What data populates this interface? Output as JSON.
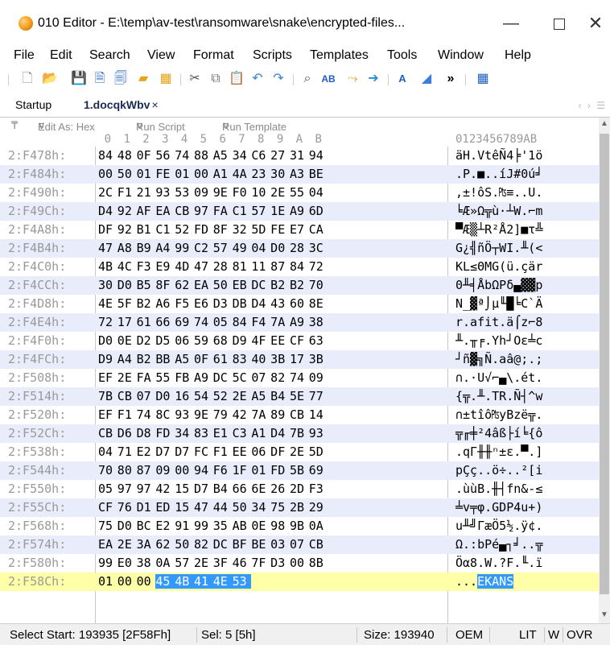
{
  "window": {
    "title": "010 Editor - E:\\temp\\av-test\\ransomware\\snake\\encrypted-files...",
    "min_glyph": "—",
    "close_glyph": "✕"
  },
  "menu": [
    "File",
    "Edit",
    "Search",
    "View",
    "Format",
    "Scripts",
    "Templates",
    "Tools",
    "Window",
    "Help"
  ],
  "toolbar": {
    "icons": [
      "new-file-icon",
      "open-icon",
      "save-icon",
      "save-as-icon",
      "save-all-icon",
      "open-folder-icon",
      "workspace-icon",
      "cut-icon",
      "copy-icon",
      "paste-icon",
      "undo-icon",
      "redo-icon",
      "find-icon",
      "replace-icon",
      "find-in-files-icon",
      "goto-icon",
      "font-icon",
      "highlight-icon",
      "calculator-icon"
    ],
    "more_glyph": "»"
  },
  "tabs": {
    "startup": "Startup",
    "active": "1.docqkWbv",
    "close_glyph": "×"
  },
  "subbar": {
    "edit_as": "Edit As: Hex",
    "run_script": "Run Script",
    "run_template": "Run Template"
  },
  "colors": {
    "row_alt": "#e9ecfb",
    "last_row": "#ffffa8",
    "selection": "#3399ff"
  },
  "hex_columns": [
    "0",
    "1",
    "2",
    "3",
    "4",
    "5",
    "6",
    "7",
    "8",
    "9",
    "A",
    "B"
  ],
  "ascii_header": "0123456789AB",
  "rows": [
    {
      "addr": "2:F478h:",
      "hex": [
        "84",
        "48",
        "0F",
        "56",
        "74",
        "88",
        "A5",
        "34",
        "C6",
        "27",
        "31",
        "94"
      ],
      "ascii": "äH.VtêÑ4╞'1ö"
    },
    {
      "addr": "2:F484h:",
      "hex": [
        "00",
        "50",
        "01",
        "FE",
        "01",
        "00",
        "A1",
        "4A",
        "23",
        "30",
        "A3",
        "BE"
      ],
      "ascii": ".P.■..íJ#0ú╛"
    },
    {
      "addr": "2:F490h:",
      "hex": [
        "2C",
        "F1",
        "21",
        "93",
        "53",
        "09",
        "9E",
        "F0",
        "10",
        "2E",
        "55",
        "04"
      ],
      "ascii": ",±!ôS.₧≡..U."
    },
    {
      "addr": "2:F49Ch:",
      "hex": [
        "D4",
        "92",
        "AF",
        "EA",
        "CB",
        "97",
        "FA",
        "C1",
        "57",
        "1E",
        "A9",
        "6D"
      ],
      "ascii": "╘Æ»Ω╦ù·┴W.⌐m"
    },
    {
      "addr": "2:F4A8h:",
      "hex": [
        "DF",
        "92",
        "B1",
        "C1",
        "52",
        "FD",
        "8F",
        "32",
        "5D",
        "FE",
        "E7",
        "CA"
      ],
      "ascii": "▀Æ▒┴R²Å2]■τ╩"
    },
    {
      "addr": "2:F4B4h:",
      "hex": [
        "47",
        "A8",
        "B9",
        "A4",
        "99",
        "C2",
        "57",
        "49",
        "04",
        "D0",
        "28",
        "3C"
      ],
      "ascii": "G¿╣ñÖ┬WI.╨(<"
    },
    {
      "addr": "2:F4C0h:",
      "hex": [
        "4B",
        "4C",
        "F3",
        "E9",
        "4D",
        "47",
        "28",
        "81",
        "11",
        "87",
        "84",
        "72"
      ],
      "ascii": "KL≤ΘMG(ü.çär"
    },
    {
      "addr": "2:F4CCh:",
      "hex": [
        "30",
        "D0",
        "B5",
        "8F",
        "62",
        "EA",
        "50",
        "EB",
        "DC",
        "B2",
        "B2",
        "70"
      ],
      "ascii": "0╨╡ÅbΩPδ▄▓▓p"
    },
    {
      "addr": "2:F4D8h:",
      "hex": [
        "4E",
        "5F",
        "B2",
        "A6",
        "F5",
        "E6",
        "D3",
        "DB",
        "D4",
        "43",
        "60",
        "8E"
      ],
      "ascii": "N_▓ª⌡µ╙█╘C`Ä"
    },
    {
      "addr": "2:F4E4h:",
      "hex": [
        "72",
        "17",
        "61",
        "66",
        "69",
        "74",
        "05",
        "84",
        "F4",
        "7A",
        "A9",
        "38"
      ],
      "ascii": "r.afit.ä⌠z⌐8"
    },
    {
      "addr": "2:F4F0h:",
      "hex": [
        "D0",
        "0E",
        "D2",
        "D5",
        "06",
        "59",
        "68",
        "D9",
        "4F",
        "EE",
        "CF",
        "63"
      ],
      "ascii": "╨.╥╒.Yh┘Oε╧c"
    },
    {
      "addr": "2:F4FCh:",
      "hex": [
        "D9",
        "A4",
        "B2",
        "BB",
        "A5",
        "0F",
        "61",
        "83",
        "40",
        "3B",
        "17",
        "3B"
      ],
      "ascii": "┘ñ▓╗Ñ.aâ@;.;"
    },
    {
      "addr": "2:F508h:",
      "hex": [
        "EF",
        "2E",
        "FA",
        "55",
        "FB",
        "A9",
        "DC",
        "5C",
        "07",
        "82",
        "74",
        "09"
      ],
      "ascii": "∩.·U√⌐▄\\.ét."
    },
    {
      "addr": "2:F514h:",
      "hex": [
        "7B",
        "CB",
        "07",
        "D0",
        "16",
        "54",
        "52",
        "2E",
        "A5",
        "B4",
        "5E",
        "77"
      ],
      "ascii": "{╦.╨.TR.Ñ┤^w"
    },
    {
      "addr": "2:F520h:",
      "hex": [
        "EF",
        "F1",
        "74",
        "8C",
        "93",
        "9E",
        "79",
        "42",
        "7A",
        "89",
        "CB",
        "14"
      ],
      "ascii": "∩±tîô₧yBzë╦."
    },
    {
      "addr": "2:F52Ch:",
      "hex": [
        "CB",
        "D6",
        "D8",
        "FD",
        "34",
        "83",
        "E1",
        "C3",
        "A1",
        "D4",
        "7B",
        "93"
      ],
      "ascii": "╦╓╪²4âß├í╘{ô"
    },
    {
      "addr": "2:F538h:",
      "hex": [
        "04",
        "71",
        "E2",
        "D7",
        "D7",
        "FC",
        "F1",
        "EE",
        "06",
        "DF",
        "2E",
        "5D"
      ],
      "ascii": ".qΓ╫╫ⁿ±ε.▀.]"
    },
    {
      "addr": "2:F544h:",
      "hex": [
        "70",
        "80",
        "87",
        "09",
        "00",
        "94",
        "F6",
        "1F",
        "01",
        "FD",
        "5B",
        "69"
      ],
      "ascii": "pÇç..ö÷..²[i"
    },
    {
      "addr": "2:F550h:",
      "hex": [
        "05",
        "97",
        "97",
        "42",
        "15",
        "D7",
        "B4",
        "66",
        "6E",
        "26",
        "2D",
        "F3"
      ],
      "ascii": ".ùùB.╫┤fn&-≤"
    },
    {
      "addr": "2:F55Ch:",
      "hex": [
        "CF",
        "76",
        "D1",
        "ED",
        "15",
        "47",
        "44",
        "50",
        "34",
        "75",
        "2B",
        "29"
      ],
      "ascii": "╧v╤φ.GDP4u+)"
    },
    {
      "addr": "2:F568h:",
      "hex": [
        "75",
        "D0",
        "BC",
        "E2",
        "91",
        "99",
        "35",
        "AB",
        "0E",
        "98",
        "9B",
        "0A"
      ],
      "ascii": "u╨╝ΓæÖ5½.ÿ¢."
    },
    {
      "addr": "2:F574h:",
      "hex": [
        "EA",
        "2E",
        "3A",
        "62",
        "50",
        "82",
        "DC",
        "BF",
        "BE",
        "03",
        "07",
        "CB"
      ],
      "ascii": "Ω.:bPé▄┐╛..╦"
    },
    {
      "addr": "2:F580h:",
      "hex": [
        "99",
        "E0",
        "38",
        "0A",
        "57",
        "2E",
        "3F",
        "46",
        "7F",
        "D3",
        "00",
        "8B"
      ],
      "ascii": "Öα8.W.?F.╙.ï"
    },
    {
      "addr": "2:F58Ch:",
      "hex": [
        "01",
        "00",
        "00",
        "45",
        "4B",
        "41",
        "4E",
        "53"
      ],
      "ascii_plain": "...",
      "ascii_selected": "EKANS",
      "hex_selected_from": 3
    }
  ],
  "status": {
    "select": "Select Start: 193935 [2F58Fh]",
    "sel": "Sel: 5 [5h]",
    "size": "Size: 193940",
    "encoding": "OEM",
    "endian": "LIT",
    "mode_w": "W",
    "mode_ovr": "OVR"
  }
}
